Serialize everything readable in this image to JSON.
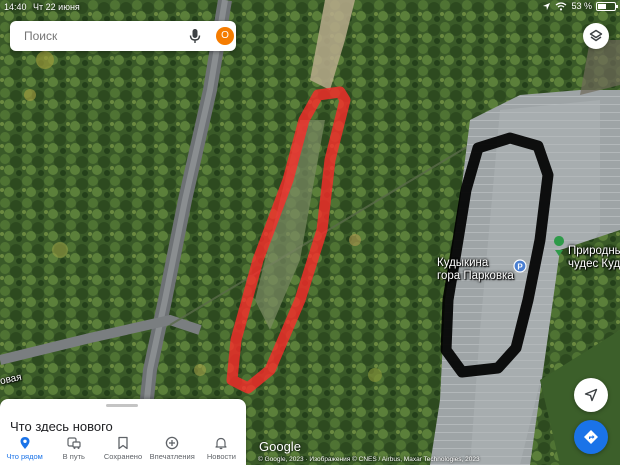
{
  "status_bar": {
    "time": "14:40",
    "date": "Чт 22 июня",
    "battery": "53 %",
    "battery_level": 0.53
  },
  "search": {
    "placeholder": "Поиск",
    "avatar_initial": "О"
  },
  "map": {
    "labels": {
      "parking_line1": "Кудыкина",
      "parking_line2": "гора Парковка",
      "park_line1": "Природный",
      "park_line2": "чудес Куд",
      "street": "овая"
    },
    "annotation_colors": {
      "red_loop": "#ff2a2a",
      "black_loop": "#000000"
    }
  },
  "bottom_sheet": {
    "title": "Что здесь нового"
  },
  "nav": {
    "items": [
      {
        "label": "Что рядом",
        "icon": "location-pin-icon",
        "active": true
      },
      {
        "label": "В путь",
        "icon": "commute-icon",
        "active": false
      },
      {
        "label": "Сохранено",
        "icon": "bookmark-icon",
        "active": false
      },
      {
        "label": "Впечатления",
        "icon": "add-circle-icon",
        "active": false
      },
      {
        "label": "Новости",
        "icon": "bell-icon",
        "active": false
      }
    ]
  },
  "attribution": {
    "logo": "Google",
    "text": "© Google, 2023 · Изображения © CNES / Airbus, Maxar Technologies, 2023"
  }
}
